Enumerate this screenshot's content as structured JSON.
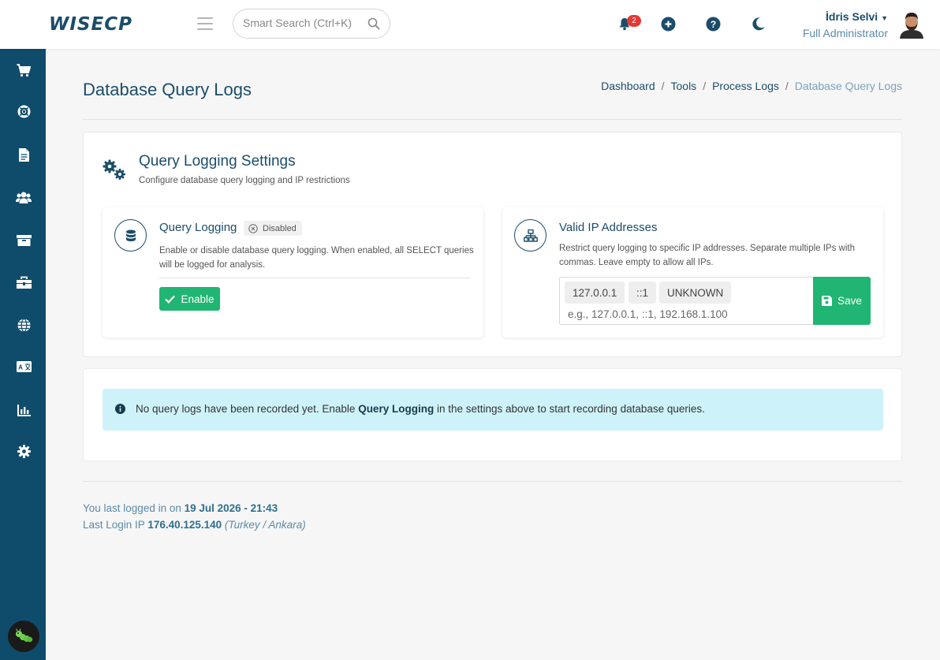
{
  "header": {
    "logo": "WISECP",
    "search_placeholder": "Smart Search (Ctrl+K)",
    "notification_count": "2",
    "user_name": "İdris Selvi",
    "user_role": "Full Administrator"
  },
  "sidebar": {
    "items": [
      {
        "icon": "cart-icon"
      },
      {
        "icon": "lifebuoy-icon"
      },
      {
        "icon": "document-icon"
      },
      {
        "icon": "users-icon"
      },
      {
        "icon": "box-icon"
      },
      {
        "icon": "toolbox-icon"
      },
      {
        "icon": "globe-icon"
      },
      {
        "icon": "language-icon"
      },
      {
        "icon": "chart-icon"
      },
      {
        "icon": "gear-icon"
      }
    ]
  },
  "page": {
    "title": "Database Query Logs",
    "breadcrumb": [
      "Dashboard",
      "Tools",
      "Process Logs",
      "Database Query Logs"
    ]
  },
  "settings": {
    "title": "Query Logging Settings",
    "subtitle": "Configure database query logging and IP restrictions",
    "query_logging": {
      "title": "Query Logging",
      "status": "Disabled",
      "desc_line1": "Enable or disable database query logging. When enabled, all SELECT queries",
      "desc_line2": "will be logged for analysis.",
      "enable_label": "Enable"
    },
    "valid_ips": {
      "title": "Valid IP Addresses",
      "desc_line1": "Restrict query logging to specific IP addresses. Separate multiple IPs with",
      "desc_line2": "commas. Leave empty to allow all IPs.",
      "tags": [
        "127.0.0.1",
        "::1",
        "UNKNOWN"
      ],
      "placeholder": "e.g., 127.0.0.1, ::1, 192.168.1.100",
      "save_label": "Save"
    }
  },
  "alert": {
    "prefix": "No query logs have been recorded yet. Enable ",
    "strong": "Query Logging",
    "suffix": " in the settings above to start recording database queries."
  },
  "footer": {
    "login_prefix": "You last logged in on ",
    "login_date": "19 Jul 2026 - 21:43",
    "ip_prefix": "Last Login IP ",
    "ip": "176.40.125.140",
    "location": "(Turkey / Ankara)"
  },
  "colors": {
    "sidebar_bg": "#0f4c6b",
    "primary_text": "#1b4d6a",
    "success": "#20b573",
    "alert_bg": "#cef2fa",
    "badge": "#e53935"
  }
}
